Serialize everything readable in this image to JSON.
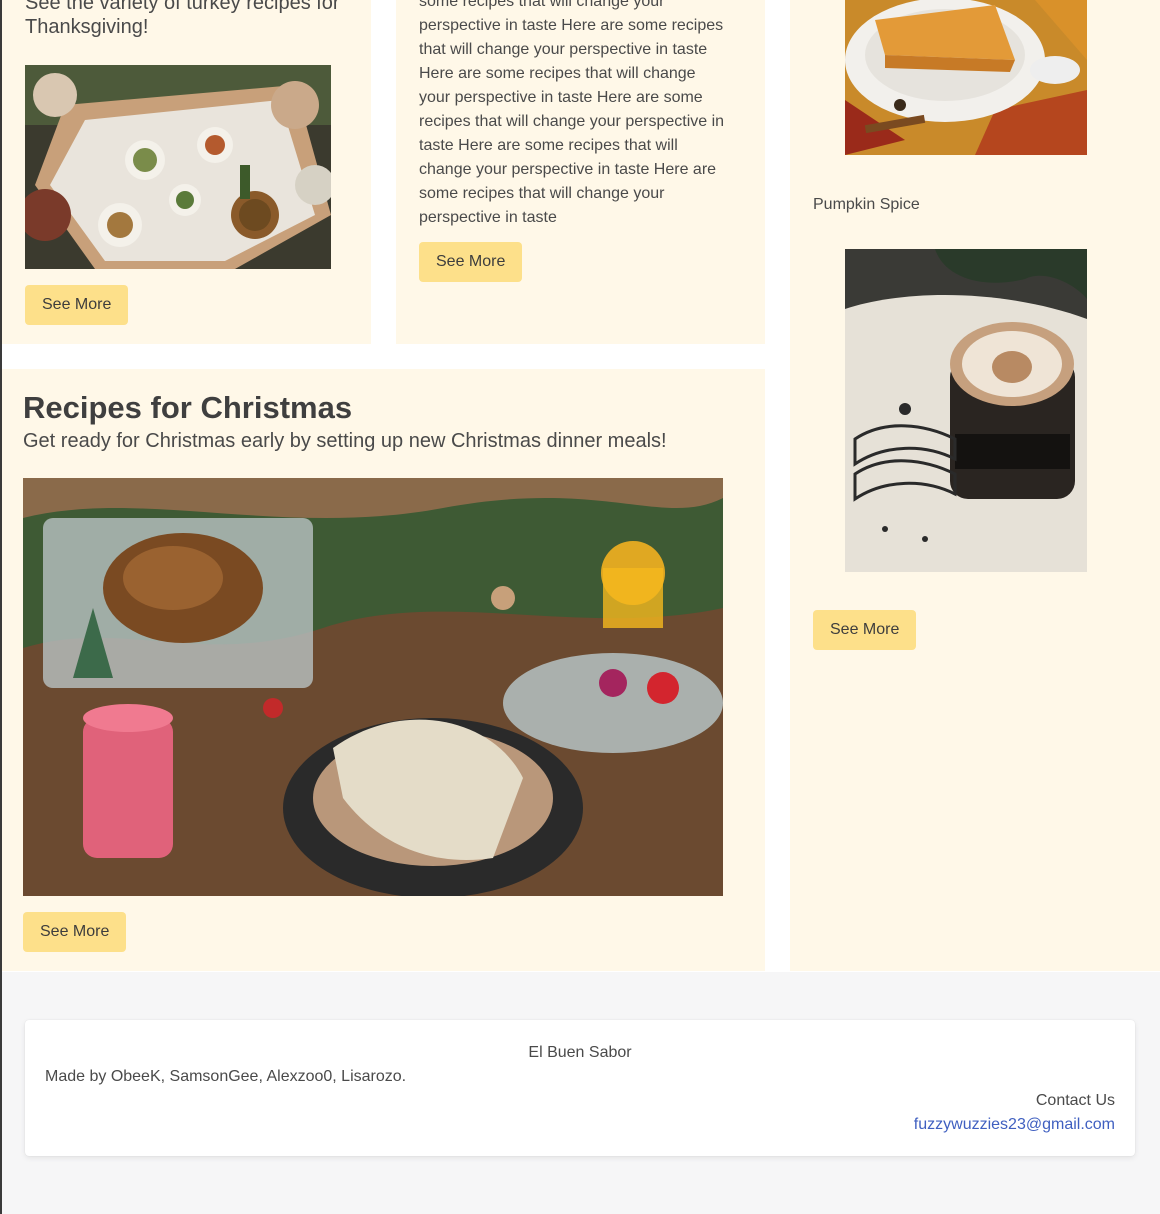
{
  "thanksgiving_card": {
    "subtitle": "See the variety of turkey recipes for Thanksgiving!",
    "image_alt": "Family Thanksgiving dinner table",
    "button_label": "See More"
  },
  "text_card": {
    "body": "some recipes that will change your perspective in taste Here are some recipes that will change your perspective in taste Here are some recipes that will change your perspective in taste Here are some recipes that will change your perspective in taste Here are some recipes that will change your perspective in taste Here are some recipes that will change your perspective in taste",
    "button_label": "See More"
  },
  "christmas_card": {
    "title": "Recipes for Christmas",
    "subtitle": "Get ready for Christmas early by setting up new Christmas dinner meals!",
    "image_alt": "Christmas dinner table with candle and plates",
    "button_label": "See More"
  },
  "pumpkin_card": {
    "pie_image_alt": "Slice of pumpkin pie",
    "label": "Pumpkin Spice",
    "latte_image_alt": "Pumpkin latte art in a glass",
    "button_label": "See More"
  },
  "footer": {
    "brand": "El Buen Sabor",
    "made_by": "Made by ObeeK, SamsonGee, Alexzoo0, Lisarozo.",
    "contact_heading": "Contact Us",
    "email": "fuzzywuzzies23@gmail.com"
  },
  "colors": {
    "card_bg": "#fff8e8",
    "button_bg": "#fde08a",
    "link": "#3f5fc0",
    "page_bg": "#f6f6f7"
  }
}
